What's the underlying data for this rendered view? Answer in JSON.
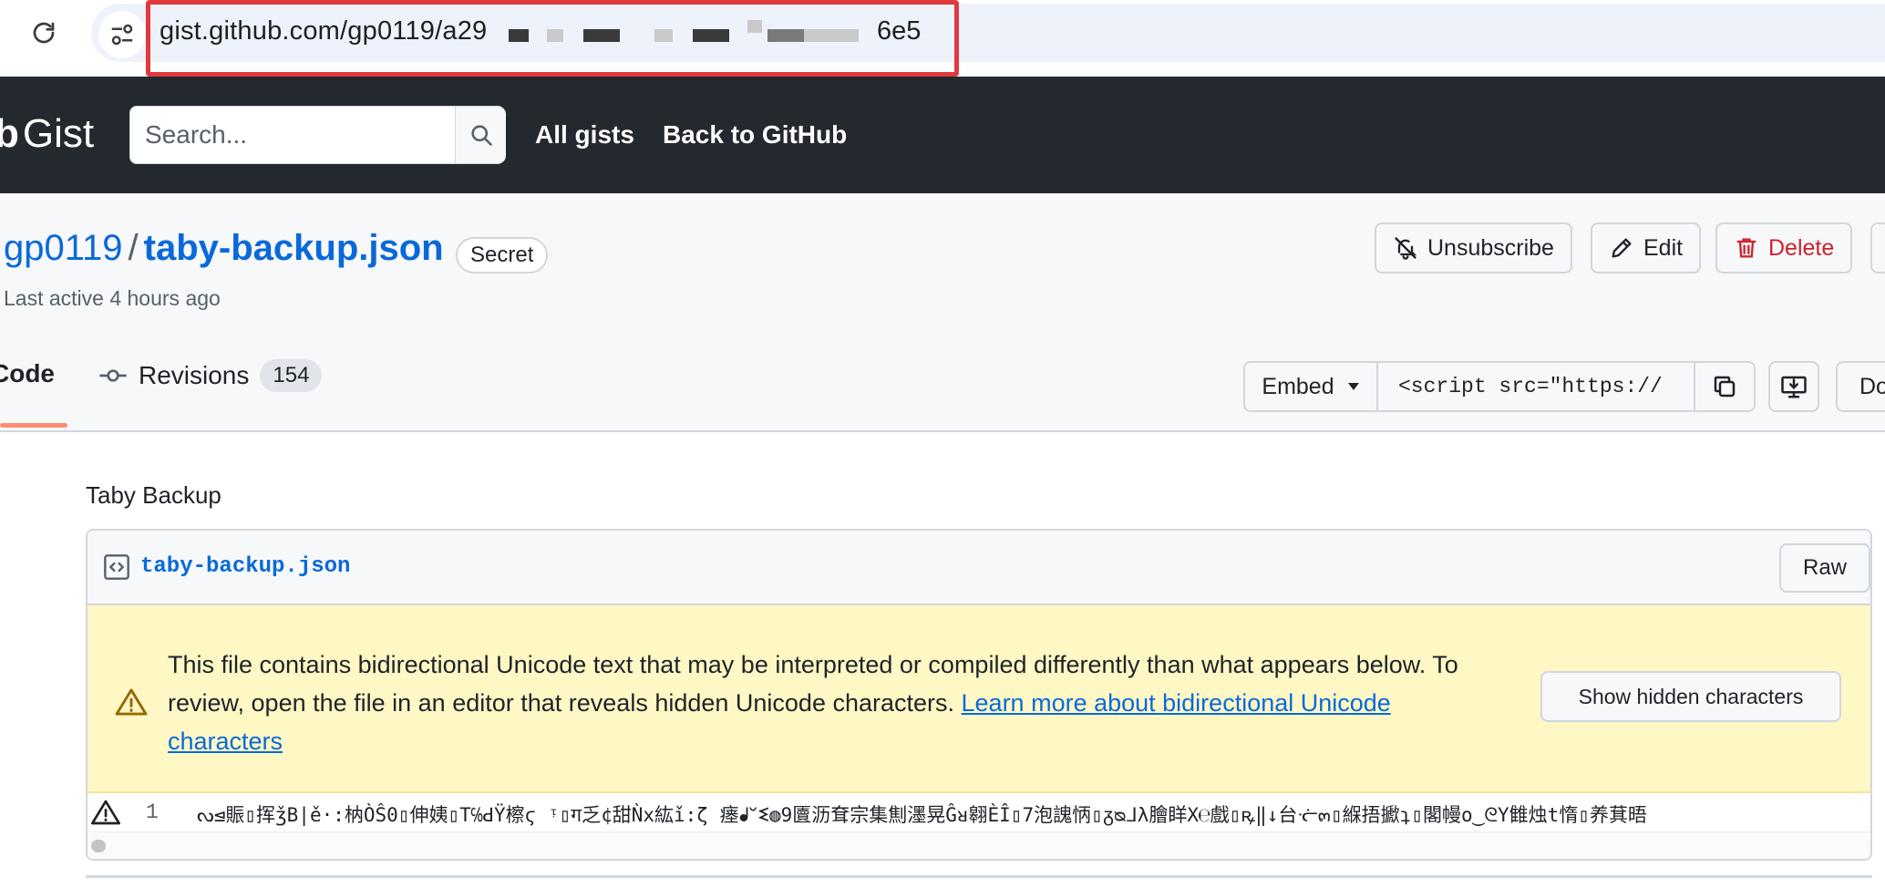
{
  "browser": {
    "url_visible_start": "gist.github.com/gp0119/a29",
    "url_visible_end": "6e5"
  },
  "header": {
    "brand_bold": "b",
    "brand_word": "Gist",
    "search_placeholder": "Search...",
    "nav": [
      "All gists",
      "Back to GitHub"
    ]
  },
  "gist": {
    "owner": "gp0119",
    "separator": "/",
    "filename": "taby-backup.json",
    "badge": "Secret",
    "last_active": "Last active 4 hours ago",
    "actions": {
      "unsubscribe": "Unsubscribe",
      "edit": "Edit",
      "delete": "Delete"
    },
    "tabs": {
      "code": "Code",
      "revisions": "Revisions",
      "revisions_count": "154"
    },
    "embed": {
      "label": "Embed",
      "value": "<script src=\"https://"
    },
    "download_label": "Do",
    "description": "Taby Backup"
  },
  "file": {
    "name": "taby-backup.json",
    "raw_label": "Raw",
    "warning_text": "This file contains bidirectional Unicode text that may be interpreted or compiled differently than what appears below. To review, open the file in an editor that reveals hidden Unicode characters. ",
    "warning_link": "Learn more about bidirectional Unicode characters",
    "show_hidden_label": "Show hidden characters",
    "line_number": "1",
    "line_content": "ᔓ⊴賑▯挥ǯB|ě·:枘ÒŜ0▯伸姨▯T℅ꓒŸ檫ϛ ᵎ▯ग乏¢甜Ǹx紘ǐ:ζ 瘗ᖱᐡᓬ◍9匵沥耷宗集劁濹晃Ĝᴚ翱ÈÎ▯7泡謉怲▯ᵹᴓᒧλ膾眻X℮戲▯ꝶ‖↓台ᓠ๓▯緥捂擨ʇ▯閣幔o‿ᘓY雔烛t惰▯养萁晤"
  },
  "colors": {
    "header_bg": "#24292f",
    "link": "#0969da",
    "danger": "#cf222e",
    "warning_bg": "#fff8c5",
    "tab_underline": "#fd8c73",
    "url_highlight": "#e0393e"
  },
  "icons": [
    "reload-icon",
    "site-info-icon",
    "search-icon",
    "bell-slash-icon",
    "pencil-icon",
    "trash-icon",
    "commit-icon",
    "triangle-down-icon",
    "copy-icon",
    "desktop-download-icon",
    "code-square-icon",
    "alert-icon"
  ]
}
